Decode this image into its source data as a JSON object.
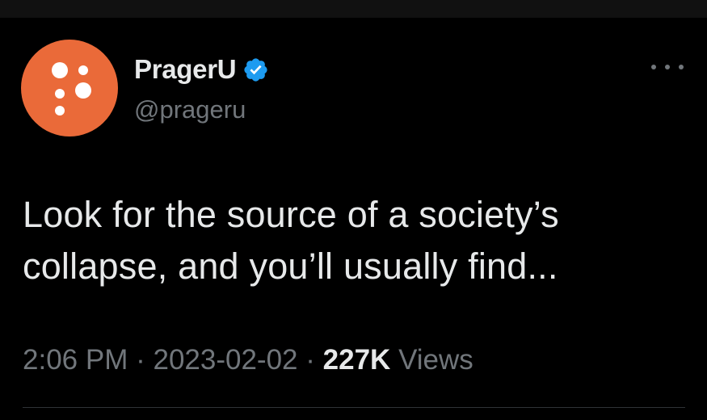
{
  "tweet": {
    "author": {
      "display_name": "PragerU",
      "handle": "@prageru",
      "verified": true,
      "avatar_color": "#ea6a39",
      "verified_color": "#1d9bf0"
    },
    "text_lines": [
      "Look for the source of a society’s",
      "collapse, and you’ll usually find..."
    ],
    "meta": {
      "time": "2:06 PM",
      "separator": "·",
      "date": "2023-02-02",
      "views_count": "227K",
      "views_label": "Views"
    },
    "icons": {
      "more": "more-horizontal-icon",
      "verified": "verified-badge-icon"
    }
  }
}
